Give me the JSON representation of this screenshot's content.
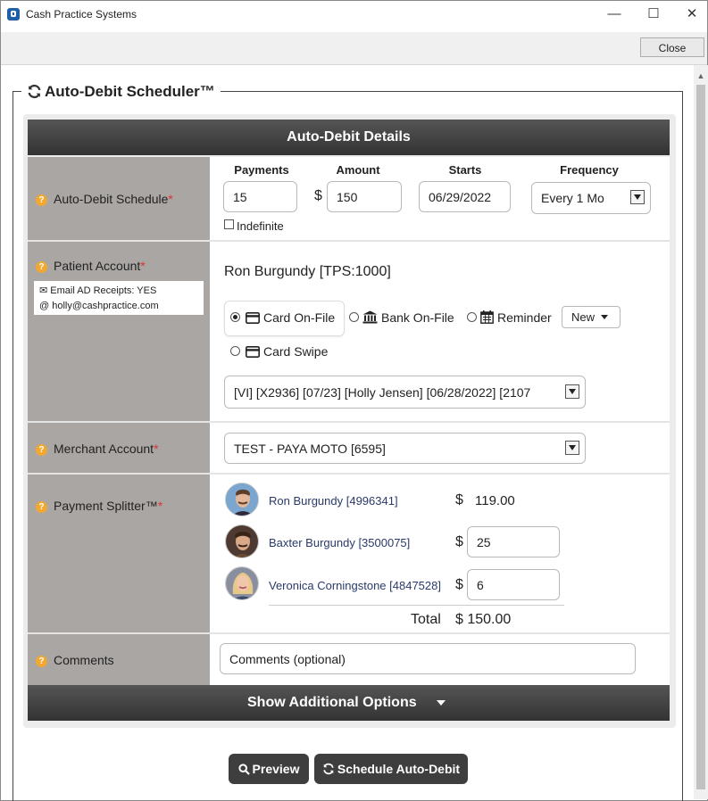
{
  "window": {
    "title": "Cash Practice Systems",
    "minimize": "—",
    "maximize": "☐",
    "close": "✕"
  },
  "toolbar": {
    "close_label": "Close"
  },
  "scheduler": {
    "title": "Auto-Debit Scheduler™",
    "header": "Auto-Debit Details",
    "schedule": {
      "label": "Auto-Debit Schedule",
      "required_mark": "*",
      "payments_header": "Payments",
      "amount_header": "Amount",
      "starts_header": "Starts",
      "frequency_header": "Frequency",
      "payments_value": "15",
      "currency": "$",
      "amount_value": "150",
      "starts_value": "06/29/2022",
      "frequency_value": "Every 1 Mo",
      "indefinite_label": "Indefinite",
      "indefinite_checked": false
    },
    "patient": {
      "label": "Patient Account",
      "required_mark": "*",
      "email_receipts": "Email AD Receipts: YES",
      "email_address": "holly@cashpractice.com",
      "name": "Ron Burgundy [TPS:1000]",
      "payment_methods": [
        {
          "label": "Card On-File",
          "icon": "credit-card-icon",
          "selected": true
        },
        {
          "label": "Bank On-File",
          "icon": "bank-icon",
          "selected": false
        },
        {
          "label": "Reminder",
          "icon": "calendar-icon",
          "selected": false
        },
        {
          "label": "Card Swipe",
          "icon": "credit-card-icon",
          "selected": false
        }
      ],
      "new_button": "New",
      "card_selection": "[VI] [X2936] [07/23] [Holly Jensen] [06/28/2022] [2107"
    },
    "merchant": {
      "label": "Merchant Account",
      "required_mark": "*",
      "value": "TEST - PAYA MOTO [6595]"
    },
    "splitter": {
      "label": "Payment Splitter™",
      "required_mark": "*",
      "members": [
        {
          "name": "Ron Burgundy [4996341]",
          "currency": "$",
          "amount": "119.00",
          "editable": false
        },
        {
          "name": "Baxter Burgundy [3500075]",
          "currency": "$",
          "amount": "25",
          "editable": true
        },
        {
          "name": "Veronica Corningstone [4847528]",
          "currency": "$",
          "amount": "6",
          "editable": true
        }
      ],
      "total_label": "Total",
      "total_value": "$ 150.00"
    },
    "comments": {
      "label": "Comments",
      "placeholder": "Comments (optional)"
    },
    "additional_options": "Show Additional Options",
    "actions": {
      "preview": "Preview",
      "schedule": "Schedule Auto-Debit"
    }
  },
  "colors": {
    "label_bg": "#aaa6a3",
    "header_bg": "#3a3a3a",
    "required": "#dd3333",
    "help_icon": "#f0a830",
    "link_text": "#2a3a6a"
  }
}
